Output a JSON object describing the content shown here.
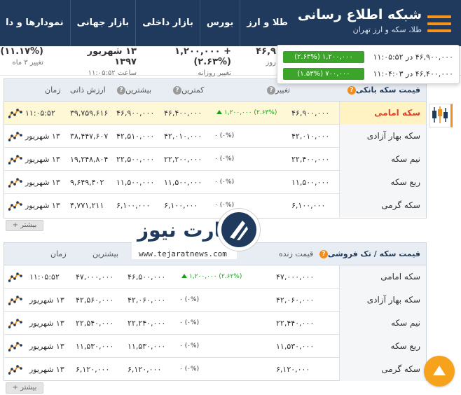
{
  "header": {
    "brand_title": "شبکه اطلاع رسانی",
    "brand_sub": "طلا، سکه و ارز تهران",
    "nav": [
      "طلا و ارز",
      "بورس",
      "بازار داخلی",
      "بازار جهانی",
      "نمودارها و دا"
    ]
  },
  "stats": [
    {
      "v1": "۱۳ شهریور ۱۳۹۷",
      "v2": "ساعت ۱۱:۰۵:۵۲"
    },
    {
      "v1": "+ ۱,۲۰۰,۰۰۰ (۲.۶۳%)",
      "v2": "تغییر روزانه"
    },
    {
      "v1": "۴۶,۹",
      "v2": "روز"
    },
    {
      "v1": "(۱۱.۱۷%)",
      "v2": "تغییر ۳ ماه"
    }
  ],
  "popup": [
    {
      "pill": "۱,۲۰۰,۰۰۰ (۲.۶۳%)",
      "text": "۴۶,۹۰۰,۰۰۰ در ۱۱:۰۵:۵۲"
    },
    {
      "pill": "۷۰۰,۰۰۰ (۱.۵۳%)",
      "text": "۴۶,۴۰۰,۰۰۰ در ۱۱:۰۴:۰۳"
    }
  ],
  "table1": {
    "title": "قیمت سکه بانکی",
    "headers": {
      "change": "تغییر",
      "low": "کمترین",
      "high": "بیشترین",
      "intrinsic": "ارزش ذاتی",
      "time": "زمان"
    },
    "rows": [
      {
        "name": "سکه امامی",
        "price": "۴۶,۹۰۰,۰۰۰",
        "change": "(۲.۶۳%) ۱,۲۰۰,۰۰۰",
        "low": "۴۶,۴۰۰,۰۰۰",
        "high": "۴۶,۹۰۰,۰۰۰",
        "intrinsic": "۳۹,۷۵۹,۶۱۶",
        "time": "۱۱:۰۵:۵۲"
      },
      {
        "name": "سکه بهار آزادی",
        "price": "۴۲,۰۱۰,۰۰۰",
        "change": "(۰%) ۰",
        "low": "۴۲,۰۱۰,۰۰۰",
        "high": "۴۲,۵۱۰,۰۰۰",
        "intrinsic": "۳۸,۴۴۷,۶۰۷",
        "time": "۱۳ شهریور"
      },
      {
        "name": "نیم سکه",
        "price": "۲۲,۴۰۰,۰۰۰",
        "change": "(۰%) ۰",
        "low": "۲۲,۲۰۰,۰۰۰",
        "high": "۲۲,۵۰۰,۰۰۰",
        "intrinsic": "۱۹,۲۴۸,۸۰۴",
        "time": "۱۳ شهریور"
      },
      {
        "name": "ربع سکه",
        "price": "۱۱,۵۰۰,۰۰۰",
        "change": "(۰%) ۰",
        "low": "۱۱,۵۰۰,۰۰۰",
        "high": "۱۱,۵۰۰,۰۰۰",
        "intrinsic": "۹,۶۴۹,۴۰۲",
        "time": "۱۳ شهریور"
      },
      {
        "name": "سکه گرمی",
        "price": "۶,۱۰۰,۰۰۰",
        "change": "(۰%) ۰",
        "low": "۶,۱۰۰,۰۰۰",
        "high": "۶,۱۰۰,۰۰۰",
        "intrinsic": "۴,۷۷۱,۲۱۱",
        "time": "۱۳ شهریور"
      }
    ],
    "more": "+ بیشتر"
  },
  "table2": {
    "title": "قیمت سکه / تک فروشی",
    "headers": {
      "live": "قیمت زنده",
      "high": "بیشترین",
      "time": "زمان"
    },
    "rows": [
      {
        "name": "سکه امامی",
        "price": "۴۷,۰۰۰,۰۰۰",
        "change": "(۲.۶۲%) ۱,۲۰۰,۰۰۰",
        "low": "۴۶,۵۰۰,۰۰۰",
        "high": "۴۷,۰۰۰,۰۰۰",
        "time": "۱۱:۰۵:۵۲"
      },
      {
        "name": "سکه بهار آزادی",
        "price": "۴۲,۰۶۰,۰۰۰",
        "change": "(۰%) ۰",
        "low": "۴۲,۰۶۰,۰۰۰",
        "high": "۴۲,۵۶۰,۰۰۰",
        "time": "۱۳ شهریور"
      },
      {
        "name": "نیم سکه",
        "price": "۲۲,۴۴۰,۰۰۰",
        "change": "(۰%) ۰",
        "low": "۲۲,۲۴۰,۰۰۰",
        "high": "۲۲,۵۴۰,۰۰۰",
        "time": "۱۳ شهریور"
      },
      {
        "name": "ربع سکه",
        "price": "۱۱,۵۳۰,۰۰۰",
        "change": "(۰%) ۰",
        "low": "۱۱,۵۳۰,۰۰۰",
        "high": "۱۱,۵۳۰,۰۰۰",
        "time": "۱۳ شهریور"
      },
      {
        "name": "سکه گرمی",
        "price": "۶,۱۲۰,۰۰۰",
        "change": "(۰%) ۰",
        "low": "۶,۱۲۰,۰۰۰",
        "high": "۶,۱۲۰,۰۰۰",
        "time": "۱۳ شهریور"
      }
    ],
    "more": "+ بیشتر"
  },
  "logo": {
    "brand_fa": "تجارت نیوز",
    "url": "www.tejaratnews.com"
  },
  "colors": {
    "header_bg": "#1f3a5c",
    "accent": "#f28c1b",
    "up": "#18a01d",
    "highlight_name": "#e0442b"
  }
}
